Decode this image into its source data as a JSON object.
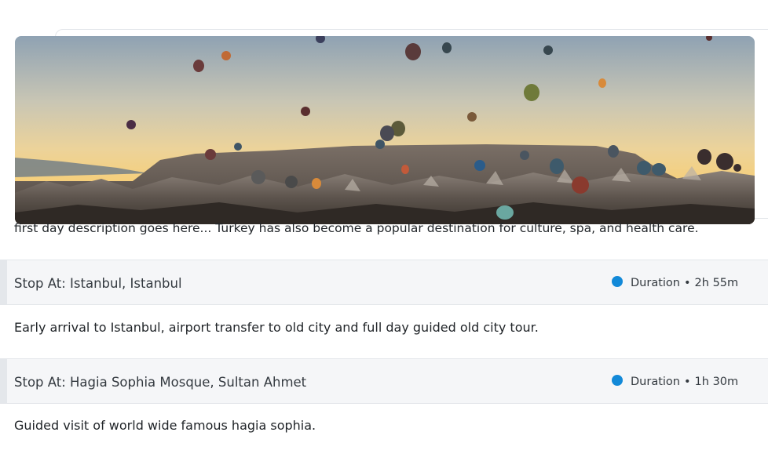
{
  "day": {
    "description": "first day description goes here... Turkey has also become a popular destination for culture, spa, and health care."
  },
  "stops": [
    {
      "title": "Stop At: Istanbul, Istanbul",
      "duration_label": "Duration",
      "separator": "•",
      "duration": "2h 55m",
      "description": "Early arrival to Istanbul, airport transfer to old city and full day guided old city tour."
    },
    {
      "title": "Stop At: Hagia Sophia Mosque, Sultan Ahmet",
      "duration_label": "Duration",
      "separator": "•",
      "duration": "1h 30m",
      "description": "Guided visit of world wide famous hagia sophia."
    }
  ],
  "colors": {
    "duration_dot": "#1289d8",
    "header_bg": "#f5f6f8"
  }
}
